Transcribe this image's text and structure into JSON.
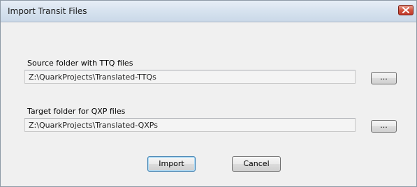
{
  "window": {
    "title": "Import Transit Files",
    "close_icon": "close-icon"
  },
  "source": {
    "label": "Source folder with TTQ files",
    "value": "Z:\\QuarkProjects\\Translated-TTQs",
    "browse_label": "..."
  },
  "target": {
    "label": "Target folder for QXP files",
    "value": "Z:\\QuarkProjects\\Translated-QXPs",
    "browse_label": "..."
  },
  "actions": {
    "import_label": "Import",
    "cancel_label": "Cancel"
  }
}
